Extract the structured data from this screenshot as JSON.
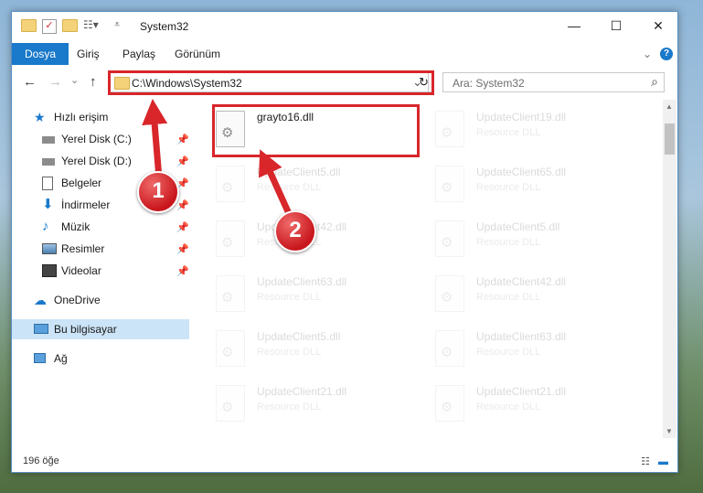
{
  "window": {
    "title": "System32",
    "controls": {
      "minimize": "—",
      "maximize": "☐",
      "close": "✕"
    }
  },
  "ribbon": {
    "tabs": [
      {
        "label": "Dosya"
      },
      {
        "label": "Giriş"
      },
      {
        "label": "Paylaş"
      },
      {
        "label": "Görünüm"
      }
    ],
    "expand": "⌄",
    "help": "?"
  },
  "navigation": {
    "back": "←",
    "forward": "→",
    "recent": "⌄",
    "up": "↑"
  },
  "address": {
    "path": "C:\\Windows\\System32",
    "dropdown": "⌄",
    "refresh": "↻"
  },
  "search": {
    "placeholder": "Ara: System32",
    "icon": "⌕"
  },
  "sidebar": {
    "items": [
      {
        "label": "Hızlı erişim",
        "icon": "star-icon",
        "pinned": false
      },
      {
        "label": "Yerel Disk (C:)",
        "icon": "drive-icon",
        "pinned": true
      },
      {
        "label": "Yerel Disk (D:)",
        "icon": "drive-icon",
        "pinned": true
      },
      {
        "label": "Belgeler",
        "icon": "document-icon",
        "pinned": true
      },
      {
        "label": "İndirmeler",
        "icon": "download-icon",
        "pinned": true
      },
      {
        "label": "Müzik",
        "icon": "music-icon",
        "pinned": true
      },
      {
        "label": "Resimler",
        "icon": "pictures-icon",
        "pinned": true
      },
      {
        "label": "Videolar",
        "icon": "video-icon",
        "pinned": true
      },
      {
        "label": "OneDrive",
        "icon": "cloud-icon",
        "pinned": false
      },
      {
        "label": "Bu bilgisayar",
        "icon": "computer-icon",
        "pinned": false,
        "selected": true
      },
      {
        "label": "Ağ",
        "icon": "network-icon",
        "pinned": false
      }
    ]
  },
  "files": [
    {
      "name": "grayto16.dll",
      "type": "",
      "highlighted": true
    },
    {
      "name": "UpdateClient19.dll",
      "type": "Resource DLL"
    },
    {
      "name": "UpdateClient5.dll",
      "type": "Resource DLL"
    },
    {
      "name": "UpdateClient65.dll",
      "type": "Resource DLL"
    },
    {
      "name": "UpdateClient42.dll",
      "type": "Resource DLL"
    },
    {
      "name": "UpdateClient5.dll",
      "type": "Resource DLL"
    },
    {
      "name": "UpdateClient63.dll",
      "type": "Resource DLL"
    },
    {
      "name": "UpdateClient42.dll",
      "type": "Resource DLL"
    },
    {
      "name": "UpdateClient5.dll",
      "type": "Resource DLL"
    },
    {
      "name": "UpdateClient63.dll",
      "type": "Resource DLL"
    },
    {
      "name": "UpdateClient21.dll",
      "type": "Resource DLL"
    },
    {
      "name": "UpdateClient21.dll",
      "type": "Resource DLL"
    }
  ],
  "status": {
    "count": "196 öğe"
  },
  "callouts": [
    {
      "number": "1"
    },
    {
      "number": "2"
    }
  ],
  "colors": {
    "accent": "#1979ca",
    "highlight": "#d8262b",
    "selected": "#cce4f7"
  }
}
